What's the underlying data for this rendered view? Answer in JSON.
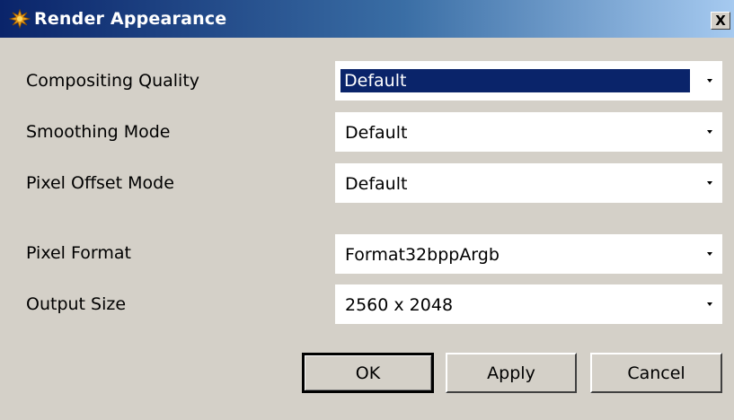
{
  "window": {
    "title": "Render Appearance",
    "close_label": "X"
  },
  "fields": [
    {
      "label": "Compositing Quality",
      "value": "Default",
      "focused": true
    },
    {
      "label": "Smoothing Mode",
      "value": "Default"
    },
    {
      "label": "Pixel Offset Mode",
      "value": "Default"
    },
    {
      "label": "Pixel Format",
      "value": "Format32bppArgb"
    },
    {
      "label": "Output Size",
      "value": "2560 x 2048"
    }
  ],
  "buttons": {
    "ok": "OK",
    "apply": "Apply",
    "cancel": "Cancel"
  },
  "icons": {
    "app": "app-icon",
    "dropdown": "chevron-down-icon"
  },
  "colors": {
    "selection": "#0a246a",
    "face": "#d4d0c8"
  }
}
